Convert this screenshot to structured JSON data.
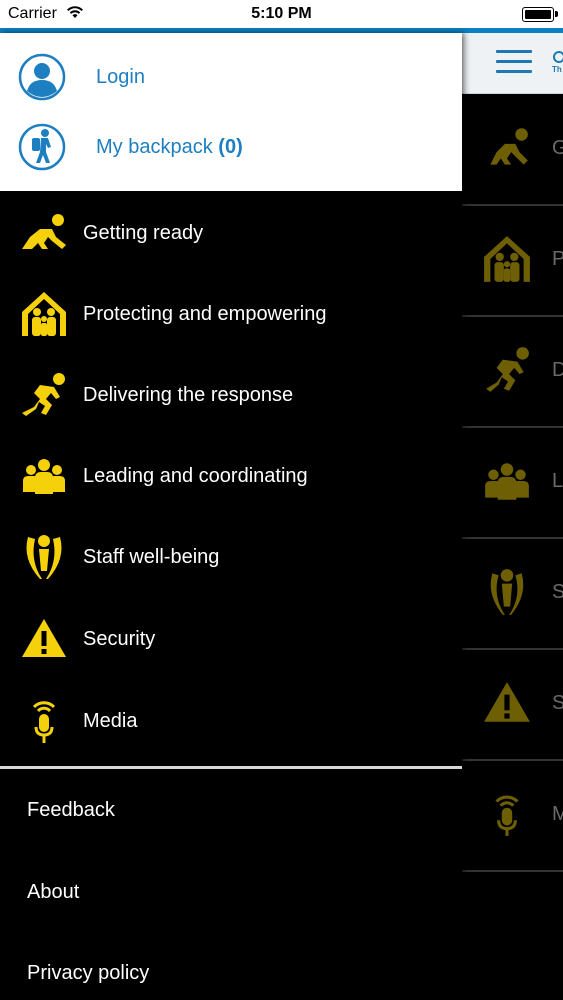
{
  "status_bar": {
    "carrier": "Carrier",
    "time": "5:10 PM"
  },
  "colors": {
    "accent": "#0b80c2",
    "icon_yellow": "#f4d10a",
    "link_blue": "#1d7fc0"
  },
  "profile": {
    "login_label": "Login",
    "backpack_label": "My backpack",
    "backpack_count": "(0)"
  },
  "menu": [
    {
      "label": "Getting ready",
      "icon": "kneeling-runner-icon"
    },
    {
      "label": "Protecting and empowering",
      "icon": "sheltered-family-icon"
    },
    {
      "label": "Delivering the response",
      "icon": "sprinter-icon"
    },
    {
      "label": "Leading and coordinating",
      "icon": "group-icon"
    },
    {
      "label": "Staff well-being",
      "icon": "raised-arms-icon"
    },
    {
      "label": "Security",
      "icon": "warning-triangle-icon"
    },
    {
      "label": "Media",
      "icon": "microphone-icon"
    }
  ],
  "footer": [
    {
      "label": "Feedback"
    },
    {
      "label": "About"
    },
    {
      "label": "Privacy policy"
    }
  ],
  "background_list": {
    "letters": [
      "G",
      "P",
      "D",
      "L",
      "S",
      "S",
      "M"
    ],
    "logo_fragment": "Th"
  }
}
